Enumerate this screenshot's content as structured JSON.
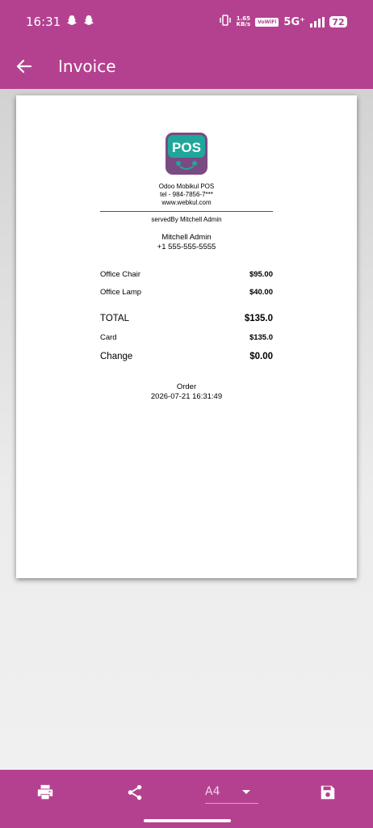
{
  "status_bar": {
    "time": "16:31",
    "net_speed_value": "1.65",
    "net_speed_unit": "KB/s",
    "volte": "VoWiFi",
    "network": "5G⁺",
    "battery": "72"
  },
  "toolbar": {
    "title": "Invoice",
    "back_icon": "arrow-left-icon"
  },
  "receipt": {
    "logo_text": "POS",
    "company": {
      "name": "Odoo Mobikul POS",
      "tel": "tel - 984-7856-7***",
      "website": "www.webkul.com"
    },
    "served_by": "servedBy Mitchell Admin",
    "customer": {
      "name": "Mitchell Admin",
      "phone": "+1 555-555-5555"
    },
    "items": [
      {
        "name": "Office Chair",
        "price": "$95.00"
      },
      {
        "name": "Office Lamp",
        "price": "$40.00"
      }
    ],
    "total_label": "TOTAL",
    "total_value": "$135.0",
    "payment_label": "Card",
    "payment_value": "$135.0",
    "change_label": "Change",
    "change_value": "$0.00",
    "order_label": "Order",
    "order_datetime": "2026-07-21 16:31:49"
  },
  "bottom_bar": {
    "print_icon": "print-icon",
    "share_icon": "share-icon",
    "page_size": "A4",
    "save_icon": "save-icon"
  },
  "colors": {
    "accent": "#b4418f",
    "logo_teal": "#1fa79a",
    "logo_purple": "#7a4a83"
  }
}
